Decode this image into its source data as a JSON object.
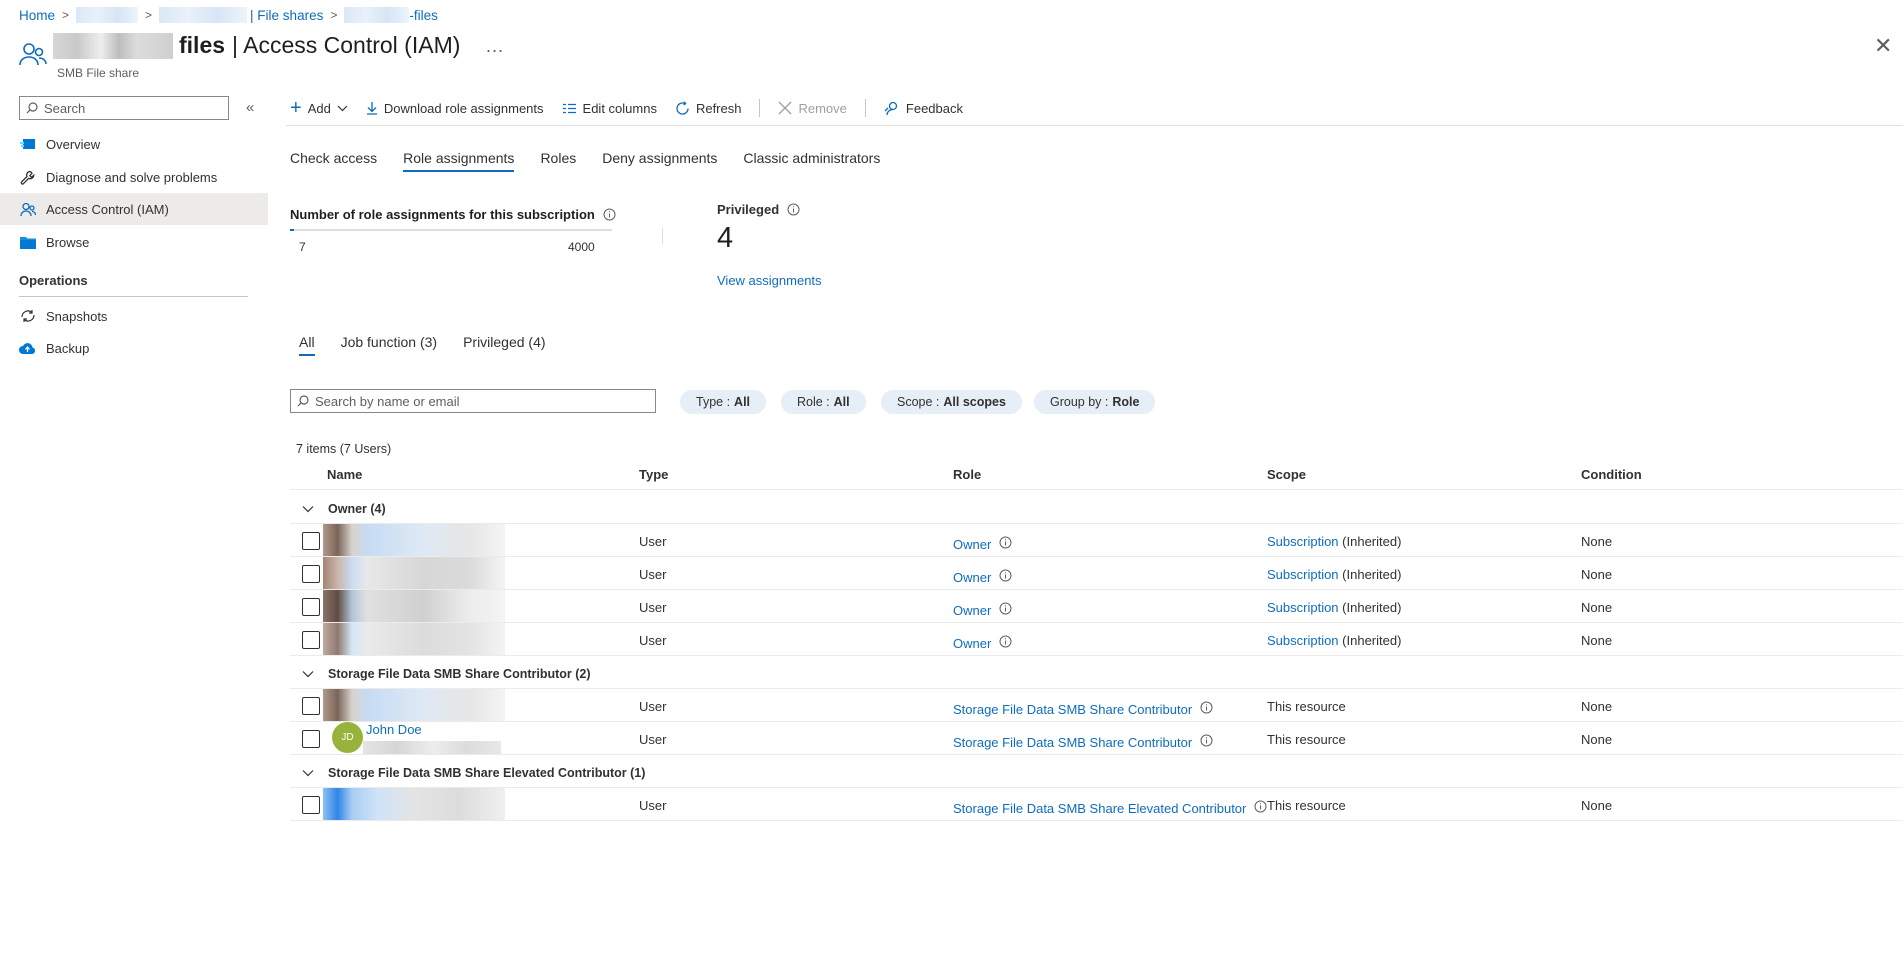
{
  "breadcrumb": {
    "home": "Home",
    "file_shares": "| File shares",
    "share_suffix": "-files"
  },
  "page": {
    "title_name": "files",
    "title_rest": "| Access Control (IAM)",
    "subtitle": "SMB File share",
    "more_label": "...",
    "close_label": "✕"
  },
  "sidebar": {
    "search_placeholder": "Search",
    "collapse_label": "«",
    "items": [
      {
        "label": "Overview",
        "icon": "overview-icon"
      },
      {
        "label": "Diagnose and solve problems",
        "icon": "wrench-icon"
      },
      {
        "label": "Access Control (IAM)",
        "icon": "people-icon"
      },
      {
        "label": "Browse",
        "icon": "folder-icon"
      }
    ],
    "section_operations": "Operations",
    "operations": [
      {
        "label": "Snapshots",
        "icon": "snapshot-icon"
      },
      {
        "label": "Backup",
        "icon": "cloud-backup-icon"
      }
    ]
  },
  "toolbar": {
    "add": "Add",
    "download": "Download role assignments",
    "edit_columns": "Edit columns",
    "refresh": "Refresh",
    "remove": "Remove",
    "feedback": "Feedback"
  },
  "tabs": [
    "Check access",
    "Role assignments",
    "Roles",
    "Deny assignments",
    "Classic administrators"
  ],
  "active_tab": "Role assignments",
  "stats": {
    "label": "Number of role assignments for this subscription",
    "current": "7",
    "max": "4000",
    "fraction": 0.00175,
    "privileged_label": "Privileged",
    "privileged_count": "4",
    "view_link": "View assignments"
  },
  "filter_tabs": [
    "All",
    "Job function (3)",
    "Privileged (4)"
  ],
  "active_filter": "All",
  "grid": {
    "search_placeholder": "Search by name or email",
    "pills": [
      {
        "key": "Type :",
        "value": "All"
      },
      {
        "key": "Role :",
        "value": "All"
      },
      {
        "key": "Scope :",
        "value": "All scopes"
      },
      {
        "key": "Group by :",
        "value": "Role"
      }
    ],
    "items_count": "7 items (7 Users)",
    "columns": [
      "Name",
      "Type",
      "Role",
      "Scope",
      "Condition"
    ],
    "groups": [
      {
        "label": "Owner (4)",
        "rows": [
          {
            "name": "",
            "type": "User",
            "role": "Owner",
            "scope_link": "Subscription",
            "scope_note": "(Inherited)",
            "condition": "None"
          },
          {
            "name": "",
            "type": "User",
            "role": "Owner",
            "scope_link": "Subscription",
            "scope_note": "(Inherited)",
            "condition": "None"
          },
          {
            "name": "",
            "type": "User",
            "role": "Owner",
            "scope_link": "Subscription",
            "scope_note": "(Inherited)",
            "condition": "None"
          },
          {
            "name": "",
            "type": "User",
            "role": "Owner",
            "scope_link": "Subscription",
            "scope_note": "(Inherited)",
            "condition": "None"
          }
        ]
      },
      {
        "label": "Storage File Data SMB Share Contributor (2)",
        "rows": [
          {
            "name": "",
            "type": "User",
            "role": "Storage File Data SMB Share Contributor",
            "scope_text": "This resource",
            "condition": "None"
          },
          {
            "name": "John Doe",
            "initials": "JD",
            "type": "User",
            "role": "Storage File Data SMB Share Contributor",
            "scope_text": "This resource",
            "condition": "None"
          }
        ]
      },
      {
        "label": "Storage File Data SMB Share Elevated Contributor (1)",
        "rows": [
          {
            "name": "",
            "type": "User",
            "role": "Storage File Data SMB Share Elevated Contributor",
            "scope_text": "This resource",
            "condition": "None"
          }
        ]
      }
    ]
  },
  "colors": {
    "accent": "#0f6cbd",
    "avatar_bg": "#98b33b",
    "pill_bg": "#e6eef8",
    "active_nav_bg": "#edebe9"
  }
}
